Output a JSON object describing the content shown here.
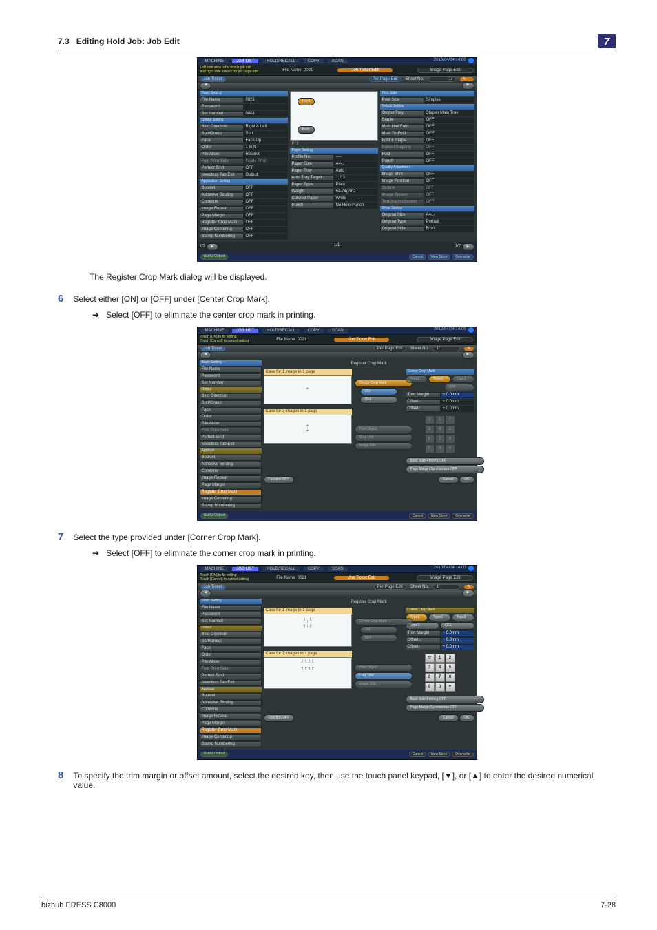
{
  "header": {
    "section": "7.3",
    "title": "Editing Hold Job: Job Edit",
    "chapter_tab": "7"
  },
  "screenshot1": {
    "top_tabs": [
      "MACHINE",
      "JOB LIST",
      "HOLD/RECALL",
      "COPY",
      "SCAN"
    ],
    "timestamp": "2010/04/04 14:00",
    "hint_line1": "Left side area is for whole job edit",
    "hint_line2": "and right side area is for per page edit",
    "file_name_field": {
      "label": "File Name",
      "value": "0021"
    },
    "job_ticket_btn": "Job Ticket Edit",
    "image_page_btn": "Image Page Edit",
    "job_ticket_tab": "Job Ticket",
    "per_page_btn": "Per Page Edit",
    "sheet_no": {
      "label": "Sheet No.",
      "value": "1/"
    },
    "basic_setting": "Basic Setting",
    "basic_rows": [
      {
        "label": "File Name",
        "value": "0021"
      },
      {
        "label": "Password",
        "value": ""
      },
      {
        "label": "Set Number",
        "value": "0001"
      }
    ],
    "output_setting": "Output Setting",
    "output_rows": [
      {
        "label": "Bind Direction",
        "value": "Right & Left"
      },
      {
        "label": "Sort/Group",
        "value": "Sort"
      },
      {
        "label": "Face",
        "value": "Face Up"
      },
      {
        "label": "Order",
        "value": "1 to N"
      },
      {
        "label": "Pile Allow",
        "value": "Restrict"
      },
      {
        "label": "Fold Print Side",
        "value": "Inside Print",
        "dim": true
      },
      {
        "label": "Perfect Bind",
        "value": "OFF"
      },
      {
        "label": "Needless Tab Exit",
        "value": "Output"
      }
    ],
    "application_setting": "Application Setting",
    "application_rows": [
      {
        "label": "Booklet",
        "value": "OFF"
      },
      {
        "label": "Adhesive Binding",
        "value": "OFF"
      },
      {
        "label": "Combine",
        "value": "OFF"
      },
      {
        "label": "Image Repeat",
        "value": "OFF"
      },
      {
        "label": "Page Margin",
        "value": "OFF"
      },
      {
        "label": "Register Crop Mark",
        "value": "OFF"
      },
      {
        "label": "Image Centering",
        "value": "OFF"
      },
      {
        "label": "Stamp  Numbering",
        "value": "OFF"
      }
    ],
    "preview_labels": {
      "front": "Front",
      "back": "Back",
      "p": "P.  1"
    },
    "paper_setting": "Paper Setting",
    "paper_rows": [
      {
        "label": "Profile No.",
        "value": "----"
      },
      {
        "label": "Paper Size",
        "value": "A4▭"
      },
      {
        "label": "Paper Tray",
        "value": "Auto"
      },
      {
        "label": "Auto Tray Target",
        "value": "1,2,3"
      },
      {
        "label": "Paper Type",
        "value": "Plain"
      },
      {
        "label": "Weight",
        "value": "64-74g/m2"
      },
      {
        "label": "Colored Paper",
        "value": "White"
      },
      {
        "label": "Punch",
        "value": "No Hole-Punch"
      }
    ],
    "print_side": "Print Side",
    "print_side_rows": [
      {
        "label": "Print Side",
        "value": "Simplex"
      }
    ],
    "output_setting2": "Output Setting",
    "output2_rows": [
      {
        "label": "Output Tray",
        "value": "Stapler Main Tray"
      },
      {
        "label": "Staple",
        "value": "OFF"
      },
      {
        "label": "Multi Half Fold",
        "value": "OFF"
      },
      {
        "label": "Multi Tri-Fold",
        "value": "OFF"
      },
      {
        "label": "Fold & Staple",
        "value": "OFF"
      },
      {
        "label": "Subset Stapling",
        "value": "OFF",
        "dim": true
      },
      {
        "label": "Fold",
        "value": "OFF"
      },
      {
        "label": "Punch",
        "value": "OFF"
      }
    ],
    "quality_adj": "Quality Adjustment",
    "quality_rows": [
      {
        "label": "Image Shift",
        "value": "OFF"
      },
      {
        "label": "Image Position",
        "value": "OFF"
      },
      {
        "label": "Outline",
        "value": "OFF",
        "dim": true
      },
      {
        "label": "Image Screen",
        "value": "OFF",
        "dim": true
      },
      {
        "label": "TextGraphicScreen",
        "value": "OFF",
        "dim": true
      }
    ],
    "other_setting": "Other Setting",
    "other_rows": [
      {
        "label": "Original Size",
        "value": "A4▭"
      },
      {
        "label": "Original Type",
        "value": "Portrait"
      },
      {
        "label": "Original Side",
        "value": "Front"
      }
    ],
    "pagers": {
      "left": "1/3",
      "mid": "1/1",
      "right": "1/2"
    },
    "footer_tips": "Useful Output",
    "footer_cancel": "Cancel",
    "footer_new": "New Store",
    "footer_over": "Overwrite"
  },
  "screenshot23": {
    "top_tabs": [
      "MACHINE",
      "JOB LIST",
      "HOLD/RECALL",
      "COPY",
      "SCAN"
    ],
    "timestamp": "2010/04/04 14:00",
    "hint_line1": "Touch [ON] to fix setting",
    "hint_line2": "Touch [Cancel] to cancel setting",
    "file_name_field": {
      "label": "File Name",
      "value": "0021"
    },
    "job_ticket_btn": "Job Ticket Edit",
    "image_page_btn": "Image Page Edit",
    "job_ticket_tab": "Job Ticket",
    "per_page_btn": "Per Page Edit",
    "sheet_no": {
      "label": "Sheet No.",
      "value": "1/"
    },
    "basic_setting": "Basic Setting",
    "left_rows": [
      {
        "label": "File Name"
      },
      {
        "label": "Password"
      },
      {
        "label": "Set Number"
      }
    ],
    "output_header": "Output",
    "output_rows": [
      {
        "label": "Bind Direction"
      },
      {
        "label": "Sort/Group"
      },
      {
        "label": "Face"
      },
      {
        "label": "Order"
      },
      {
        "label": "Pile Allow"
      },
      {
        "label": "Fold Print Side"
      },
      {
        "label": "Perfect Bind"
      },
      {
        "label": "Needless Tab Exit"
      }
    ],
    "applicati_header": "Applicati",
    "applicati_rows": [
      {
        "label": "Booklet"
      },
      {
        "label": "Adhesive Binding"
      },
      {
        "label": "Combine"
      },
      {
        "label": "Image Repeat"
      },
      {
        "label": "Page Margin"
      },
      {
        "label": "Register Crop Mark"
      },
      {
        "label": "Image Centering"
      },
      {
        "label": "Stamp  Numbering"
      }
    ],
    "dialog_title": "Register Crop Mark",
    "case1": "Case for 1 image in 1 page",
    "case2": "Case for 2 images in 1 page",
    "center_crop_btn": "Center Crop Mark",
    "on": "ON",
    "off": "OFF",
    "print_obj": "Print Object",
    "crop_unit": "Crop Unit",
    "image_unit": "Image Unit",
    "corner_crop": "Corner Crop Mark",
    "type1": "Type1",
    "type2": "Type2",
    "type3": "Type3",
    "off2": "OFF",
    "trim_margin": "Trim Margin",
    "offset_h": "Offset",
    "offset_v": "Offset",
    "pm": "+  0.0mm",
    "backside": "Back Side Printing OFF",
    "margin_sync": "Page Margin Synchronize OFF",
    "function_off": "Function OFF",
    "cancel": "Cancel",
    "ok": "OK",
    "keypad_top": "▽",
    "keys": [
      "1",
      "2",
      "3",
      "4",
      "5",
      "6",
      "7",
      "8",
      "9",
      "0",
      "▼",
      "▲"
    ]
  },
  "body": {
    "post_s1": "The Register Crop Mark dialog will be displayed.",
    "step6_num": "6",
    "step6": "Select either [ON] or [OFF] under [Center Crop Mark].",
    "step6_sub": "Select [OFF] to eliminate the center crop mark in printing.",
    "step7_num": "7",
    "step7": "Select the type provided under [Corner Crop Mark].",
    "step7_sub": "Select [OFF] to eliminate the corner crop mark in printing.",
    "step8_num": "8",
    "step8": "To specify the trim margin or offset amount, select the desired key, then use the touch panel keypad, [▼], or [▲] to enter the desired numerical value.",
    "arrow": "➔"
  },
  "footer": {
    "left": "bizhub PRESS C8000",
    "right": "7-28"
  }
}
